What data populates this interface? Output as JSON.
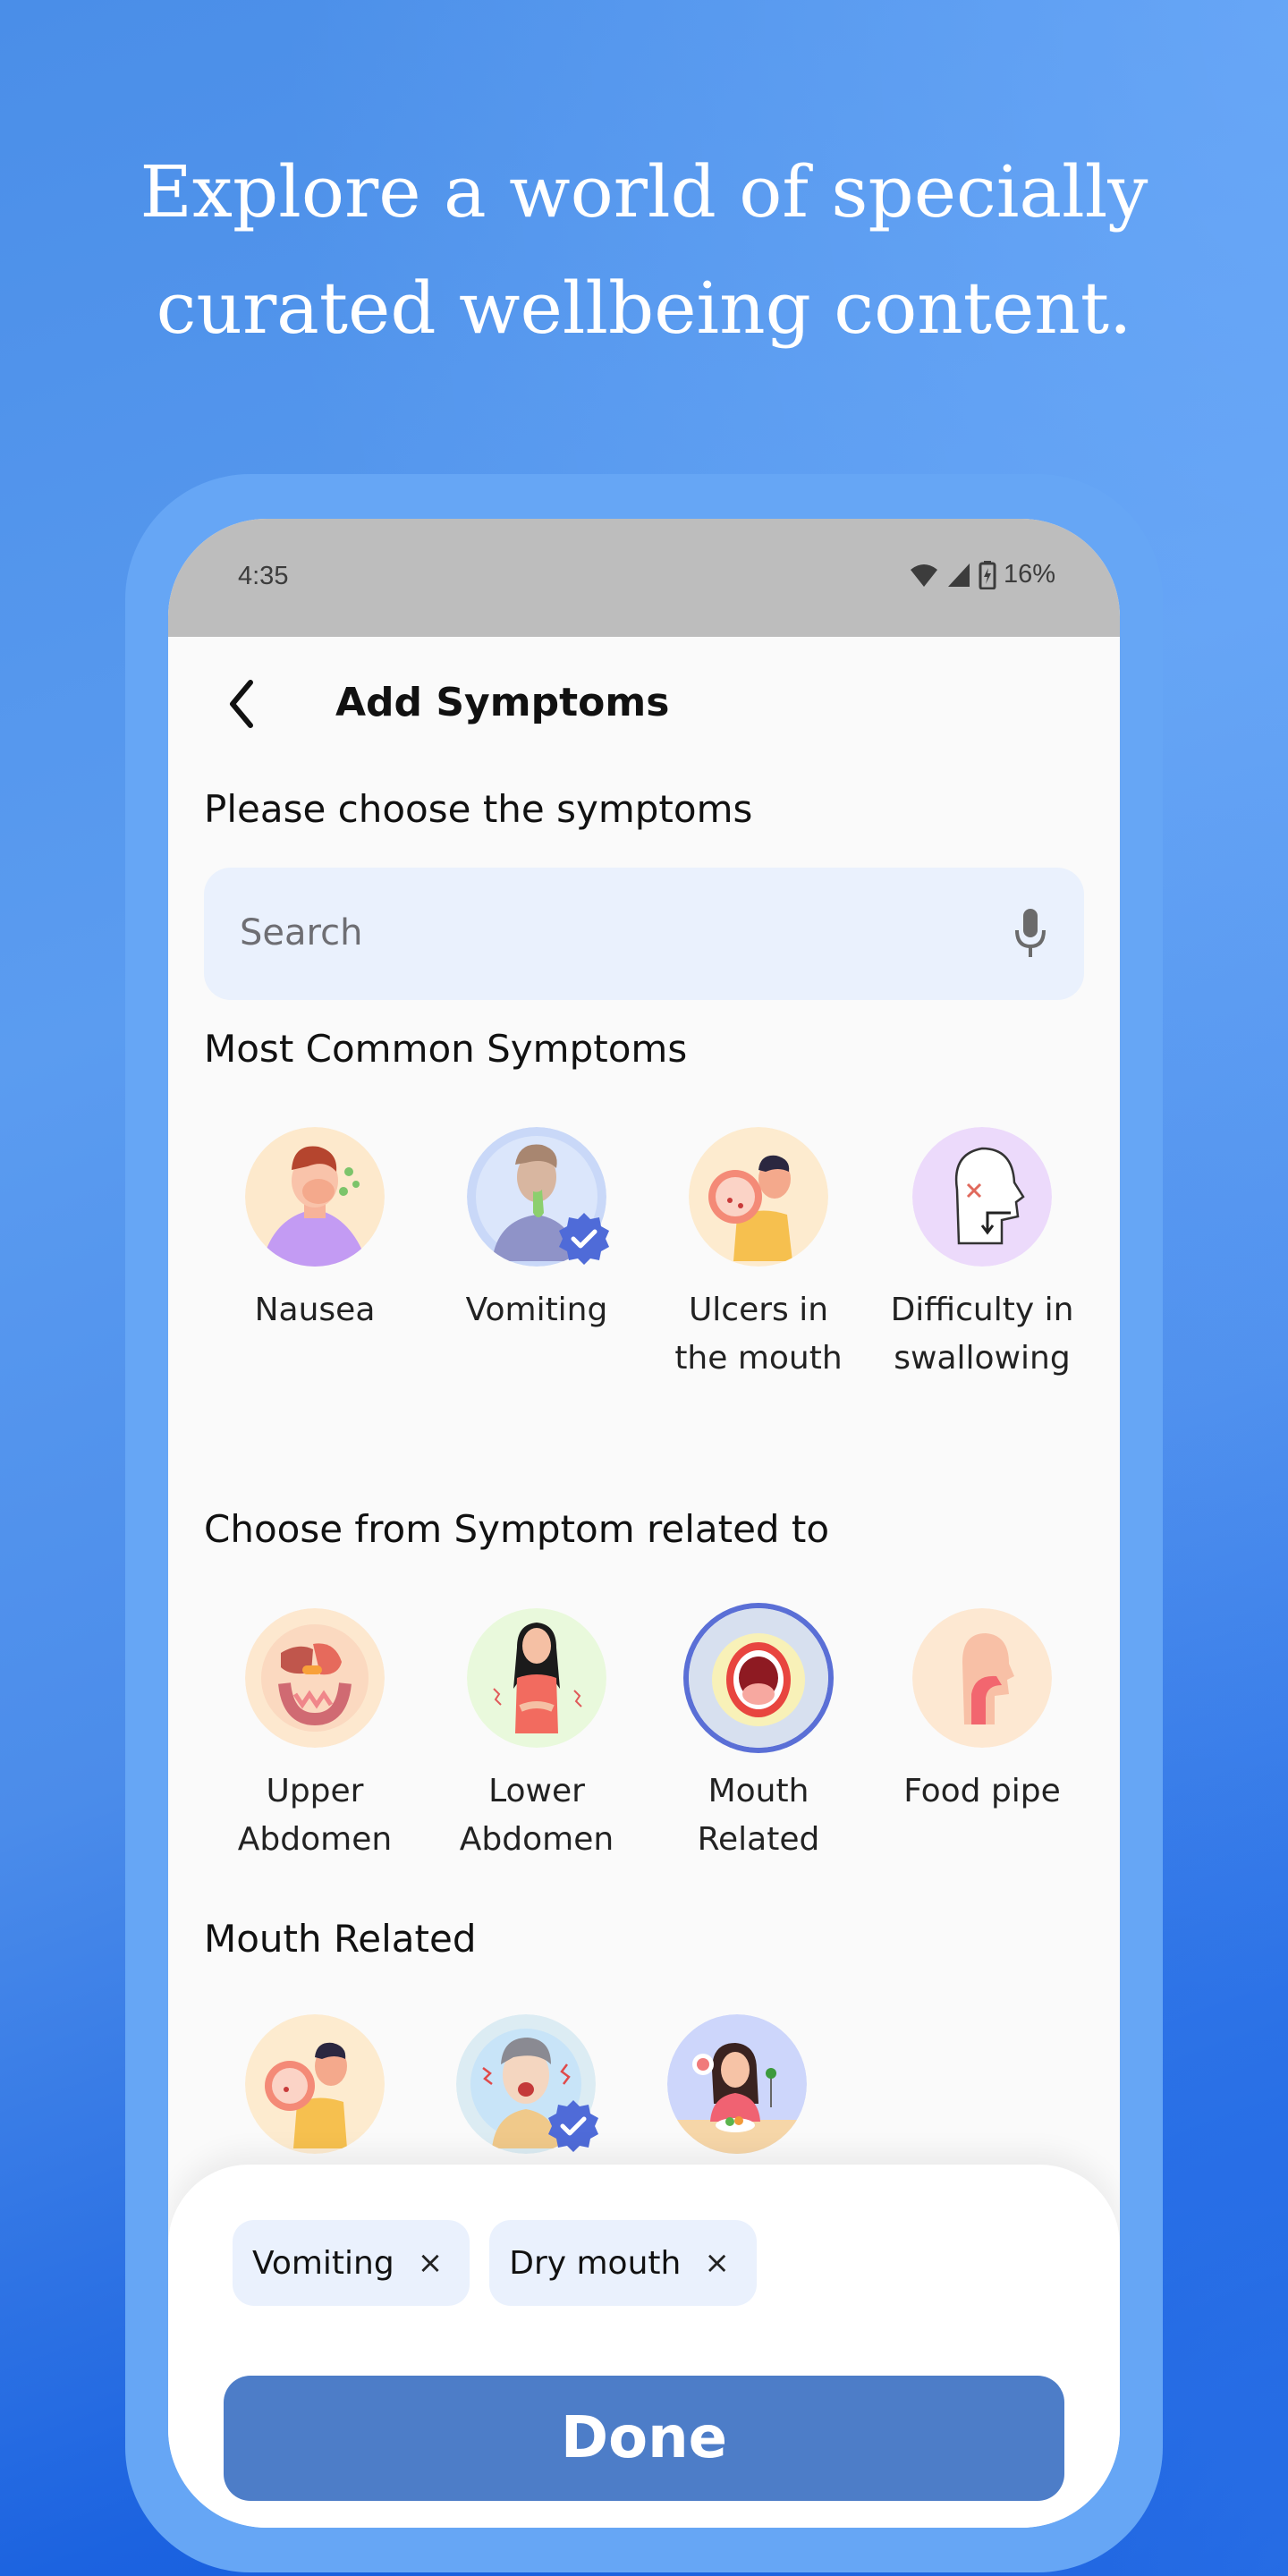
{
  "headline": {
    "line1": "Explore a world of specially",
    "line2": "curated wellbeing content."
  },
  "status_bar": {
    "time": "4:35",
    "battery": "16%",
    "icons": [
      "wifi-icon",
      "signal-icon",
      "battery-charging-icon"
    ]
  },
  "appbar": {
    "back_icon": "chevron-left-icon",
    "title": "Add Symptoms"
  },
  "prompt": "Please choose the symptoms",
  "search": {
    "placeholder": "Search",
    "value": "",
    "mic_icon": "microphone-icon"
  },
  "most_common": {
    "title": "Most Common Symptoms",
    "items": [
      {
        "line1": "Nausea",
        "line2": "",
        "bg": "#fde9cc",
        "selected": false
      },
      {
        "line1": "Vomiting",
        "line2": "",
        "bg": "#dbe6fb",
        "selected": true
      },
      {
        "line1": "Ulcers in",
        "line2": "the mouth",
        "bg": "#fdebcf",
        "selected": false
      },
      {
        "line1": "Difficulty in",
        "line2": "swallowing",
        "bg": "#ecdafb",
        "selected": false
      }
    ]
  },
  "related": {
    "title": "Choose from Symptom related to",
    "items": [
      {
        "line1": "Upper",
        "line2": "Abdomen",
        "bg": "#fde8cf",
        "selected": false
      },
      {
        "line1": "Lower",
        "line2": "Abdomen",
        "bg": "#e9f9dc",
        "selected": false
      },
      {
        "line1": "Mouth",
        "line2": "Related",
        "bg": "#d7e0ef",
        "selected": true
      },
      {
        "line1": "Food pipe",
        "line2": "",
        "bg": "#fde8d2",
        "selected": false
      }
    ]
  },
  "mouth_related": {
    "title": "Mouth Related",
    "items": [
      {
        "name": "ulcers-in-mouth",
        "bg": "#fdebcf",
        "selected": false
      },
      {
        "name": "dry-mouth",
        "bg": "#dcecf3",
        "selected": true
      },
      {
        "name": "taste-change",
        "bg": "#cdd6fb",
        "selected": false
      }
    ]
  },
  "selected_chips": [
    {
      "label": "Vomiting",
      "remove": "×"
    },
    {
      "label": "Dry mouth",
      "remove": "×"
    }
  ],
  "done_label": "Done",
  "colors": {
    "accent": "#4d7dc8",
    "badge": "#4f6bd8",
    "chip_bg": "#eaf1fd",
    "frame": "#66a6f5"
  }
}
